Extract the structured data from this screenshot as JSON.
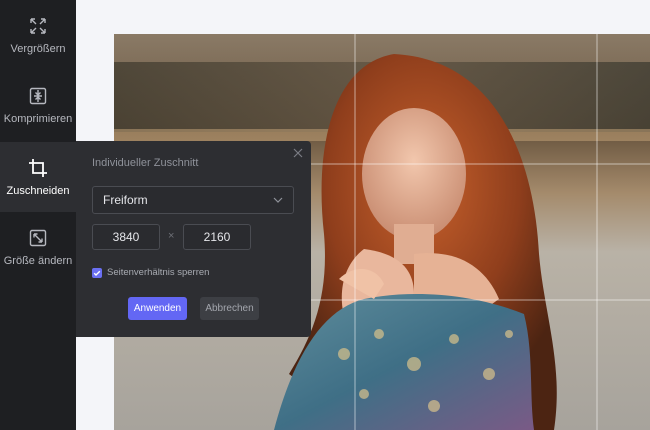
{
  "sidebar": {
    "items": [
      {
        "label": "Vergrößern",
        "icon": "expand-arrows-icon"
      },
      {
        "label": "Komprimieren",
        "icon": "compress-icon"
      },
      {
        "label": "Zuschneiden",
        "icon": "crop-icon",
        "active": true
      },
      {
        "label": "Größe ändern",
        "icon": "resize-icon"
      }
    ]
  },
  "crop_panel": {
    "title": "Individueller Zuschnitt",
    "aspect_select": {
      "value": "Freiform"
    },
    "width": "3840",
    "times": "×",
    "height": "2160",
    "lock_ratio": {
      "label": "Seitenverhältnis sperren",
      "checked": true
    },
    "apply_label": "Anwenden",
    "cancel_label": "Abbrechen"
  },
  "colors": {
    "sidebar_bg": "#1e1f22",
    "panel_bg": "#2d2e32",
    "accent": "#6367f4"
  }
}
